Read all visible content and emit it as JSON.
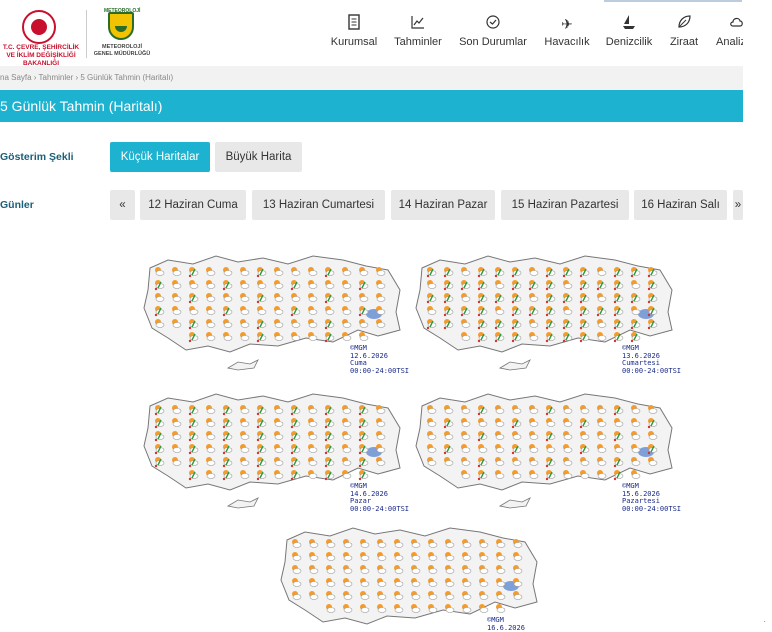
{
  "header": {
    "ministry_text": "T.C. ÇEVRE, ŞEHİRCİLİK VE İKLİM DEĞİŞİKLİĞİ BAKANLIĞI",
    "mgm_top": "METEOROLOJİ",
    "mgm_text": "METEOROLOJİ GENEL MÜDÜRLÜĞÜ",
    "nav": [
      {
        "label": "Kurumsal",
        "icon": "document-icon"
      },
      {
        "label": "Tahminler",
        "icon": "chart-icon"
      },
      {
        "label": "Son Durumlar",
        "icon": "clock-check-icon"
      },
      {
        "label": "Havacılık",
        "icon": "airplane-icon"
      },
      {
        "label": "Denizcilik",
        "icon": "ship-icon"
      },
      {
        "label": "Ziraat",
        "icon": "leaf-icon"
      },
      {
        "label": "Analiz",
        "icon": "cloud-icon"
      }
    ]
  },
  "breadcrumb": "na Sayfa › Tahminler › 5 Günlük Tahmin (Haritalı)",
  "page_title": "5 Günlük Tahmin (Haritalı)",
  "display": {
    "label": "Gösterim Şekli",
    "options": [
      "Küçük Haritalar",
      "Büyük Harita"
    ],
    "active": "Küçük Haritalar"
  },
  "days": {
    "label": "Günler",
    "prev": "«",
    "next": "»",
    "items": [
      "12 Haziran Cuma",
      "13 Haziran Cumartesi",
      "14 Haziran Pazar",
      "15 Haziran Pazartesi",
      "16 Haziran Salı"
    ]
  },
  "maps": [
    {
      "org": "©MGM",
      "date": "12.6.2026",
      "day": "Cuma",
      "time": "00:00-24:00TSI"
    },
    {
      "org": "©MGM",
      "date": "13.6.2026",
      "day": "Cumartesi",
      "time": "00:00-24:00TSI"
    },
    {
      "org": "©MGM",
      "date": "14.6.2026",
      "day": "Pazar",
      "time": "00:00-24:00TSI"
    },
    {
      "org": "©MGM",
      "date": "15.6.2026",
      "day": "Pazartesi",
      "time": "00:00-24:00TSI"
    },
    {
      "org": "©MGM",
      "date": "16.6.2026"
    }
  ],
  "colors": {
    "accent": "#1db3d0",
    "label": "#1b5f7a",
    "caption": "#1a2a8a"
  }
}
